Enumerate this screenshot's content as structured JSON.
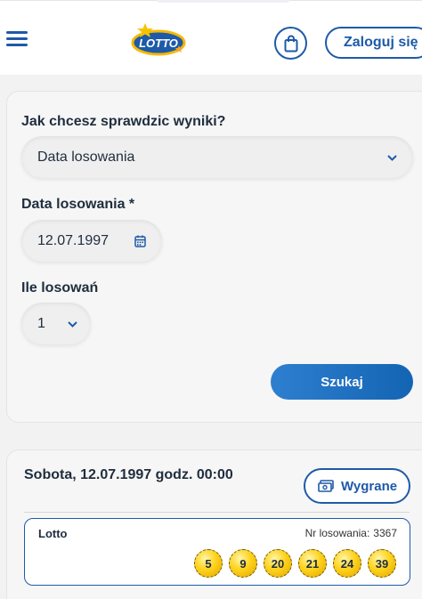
{
  "header": {
    "logo_text": "LOTTO",
    "login_label": "Zaloguj się"
  },
  "form": {
    "method_label": "Jak chcesz sprawdzic wyniki?",
    "method_value": "Data losowania",
    "date_label": "Data losowania *",
    "date_value": "12.07.1997",
    "count_label": "Ile losowań",
    "count_value": "1",
    "search_label": "Szukaj"
  },
  "result": {
    "date_text": "Sobota, 12.07.1997 godz. 00:00",
    "wins_label": "Wygrane",
    "game_name": "Lotto",
    "draw_number_label": "Nr losowania:",
    "draw_number": "3367",
    "numbers": [
      "5",
      "9",
      "20",
      "21",
      "24",
      "39"
    ]
  },
  "colors": {
    "accent": "#1e5aa8",
    "button_gradient_start": "#2f7fd0",
    "button_gradient_end": "#1464b4",
    "ball_yellow": "#ffd21c",
    "card_bg": "#f6f6f6"
  },
  "icons": {
    "menu": "hamburger-icon",
    "bag": "shopping-bag-icon",
    "calendar": "calendar-icon",
    "chevron": "chevron-down-icon",
    "money": "banknote-icon"
  }
}
